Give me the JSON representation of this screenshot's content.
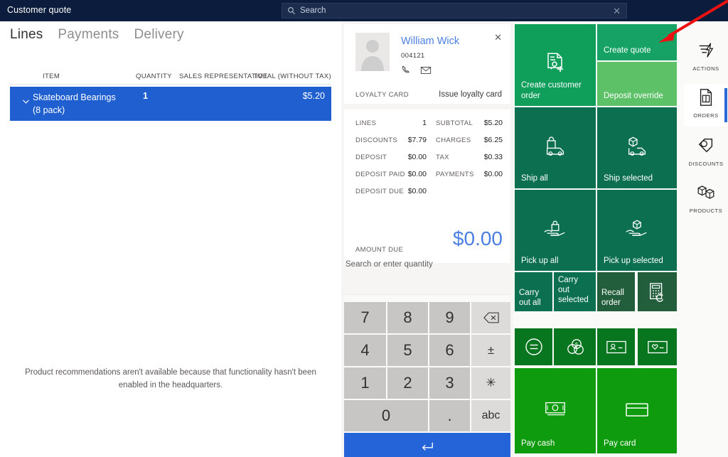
{
  "titlebar": {
    "app_title": "Customer quote",
    "search_icon": "search-icon",
    "search_placeholder": "Search",
    "search_value": "",
    "clear_icon": "close-icon"
  },
  "left_pane": {
    "tabs": [
      {
        "label": "Lines",
        "active": true
      },
      {
        "label": "Payments",
        "active": false
      },
      {
        "label": "Delivery",
        "active": false
      }
    ],
    "columns": [
      "ITEM",
      "QUANTITY",
      "SALES REPRESENTATIVE",
      "TOTAL (WITHOUT TAX)"
    ],
    "rows": [
      {
        "expander_icon": "chevron-down-icon",
        "item": "Skateboard Bearings (8 pack)",
        "quantity": "1",
        "sales_representative": "",
        "total": "$5.20",
        "selected": true
      }
    ],
    "recommendation_note": "Product recommendations aren't available because that functionality hasn't been enabled in the headquarters."
  },
  "customer": {
    "avatar_icon": "person-avatar-icon",
    "name": "William Wick",
    "id": "004121",
    "phone_icon": "phone-icon",
    "email_icon": "envelope-icon",
    "close_icon": "close-icon",
    "loyalty_label": "LOYALTY CARD",
    "loyalty_action": "Issue loyalty card"
  },
  "totals": {
    "left": [
      {
        "label": "LINES",
        "value": "1"
      },
      {
        "label": "DISCOUNTS",
        "value": "$7.79"
      },
      {
        "label": "DEPOSIT",
        "value": "$0.00"
      },
      {
        "label": "DEPOSIT PAID",
        "value": "$0.00"
      },
      {
        "label": "DEPOSIT DUE",
        "value": "$0.00"
      }
    ],
    "right": [
      {
        "label": "SUBTOTAL",
        "value": "$5.20"
      },
      {
        "label": "CHARGES",
        "value": "$6.25"
      },
      {
        "label": "TAX",
        "value": "$0.33"
      },
      {
        "label": "PAYMENTS",
        "value": "$0.00"
      }
    ],
    "amount_due_label": "AMOUNT DUE",
    "amount_due_value": "$0.00",
    "amount_due_color": "#4c7fe3"
  },
  "keypad": {
    "hint": "Search or enter quantity",
    "keys": [
      {
        "label": "7",
        "type": "digit"
      },
      {
        "label": "8",
        "type": "digit"
      },
      {
        "label": "9",
        "type": "digit"
      },
      {
        "label": "⌫",
        "type": "fn",
        "icon": "backspace-icon"
      },
      {
        "label": "4",
        "type": "digit"
      },
      {
        "label": "5",
        "type": "digit"
      },
      {
        "label": "6",
        "type": "digit"
      },
      {
        "label": "±",
        "type": "fn",
        "icon": "plus-minus-icon"
      },
      {
        "label": "1",
        "type": "digit"
      },
      {
        "label": "2",
        "type": "digit"
      },
      {
        "label": "3",
        "type": "digit"
      },
      {
        "label": "✳",
        "type": "fn",
        "icon": "asterisk-icon"
      },
      {
        "label": "0",
        "type": "digit"
      },
      {
        "label": ".",
        "type": "digit"
      },
      {
        "label": "abc",
        "type": "fn"
      }
    ],
    "enter_icon": "enter-arrow-icon"
  },
  "tiles": [
    {
      "label": "Create customer order",
      "icon": "document-add-person-icon",
      "color": "#109E5B"
    },
    {
      "label": "Create quote",
      "icon": "",
      "color": "#16A264"
    },
    {
      "label": "Deposit override",
      "icon": "",
      "color": "#5CC167"
    },
    {
      "label": "Ship all",
      "icon": "truck-bag-icon",
      "color": "#0C7050"
    },
    {
      "label": "Ship selected",
      "icon": "truck-box-icon",
      "color": "#0C7050"
    },
    {
      "label": "Pick up all",
      "icon": "hand-bag-icon",
      "color": "#0C7050"
    },
    {
      "label": "Pick up selected",
      "icon": "hand-box-icon",
      "color": "#0C7050"
    },
    {
      "label": "Carry out all",
      "icon": "",
      "color": "#0C7050"
    },
    {
      "label": "Carry out selected",
      "icon": "",
      "color": "#0C7050"
    },
    {
      "label": "Recall order",
      "icon": "",
      "color": "#235E3C"
    },
    {
      "label": "",
      "icon": "calculator-refresh-icon",
      "color": "#235E3C"
    },
    {
      "label": "",
      "icon": "equals-circle-icon",
      "color": "#08751F"
    },
    {
      "label": "",
      "icon": "coins-currency-icon",
      "color": "#08751F"
    },
    {
      "label": "",
      "icon": "id-card-icon",
      "color": "#08751F"
    },
    {
      "label": "",
      "icon": "gift-card-icon",
      "color": "#08751F"
    },
    {
      "label": "Pay cash",
      "icon": "cash-banknote-icon",
      "color": "#0E9B0E"
    },
    {
      "label": "Pay card",
      "icon": "credit-card-icon",
      "color": "#0E9B0E"
    }
  ],
  "rail": [
    {
      "label": "ACTIONS",
      "icon": "actions-lightning-icon",
      "selected": false
    },
    {
      "label": "ORDERS",
      "icon": "orders-document-icon",
      "selected": true
    },
    {
      "label": "DISCOUNTS",
      "icon": "discount-tags-icon",
      "selected": false
    },
    {
      "label": "PRODUCTS",
      "icon": "products-boxes-icon",
      "selected": false
    }
  ],
  "annotation": {
    "arrow_color": "#ee1111",
    "name": "red-arrow-annotation"
  }
}
